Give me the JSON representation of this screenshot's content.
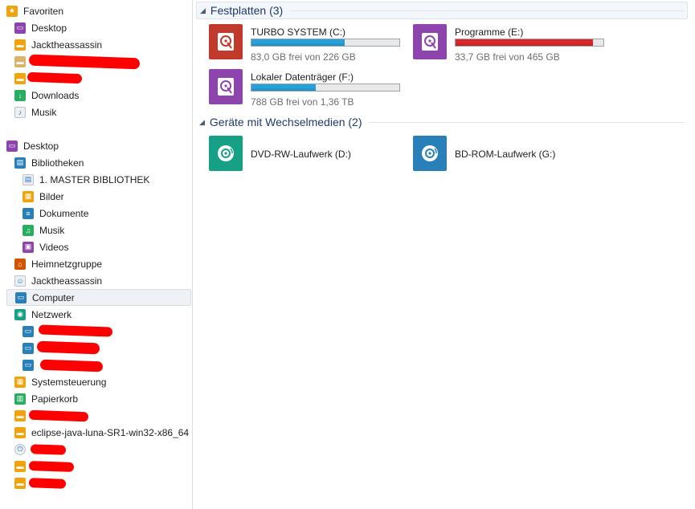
{
  "nav": {
    "favorites": {
      "header": "Favoriten",
      "items": [
        "Desktop",
        "Jacktheassassin",
        "",
        "",
        "Downloads",
        "Musik"
      ]
    },
    "desktop": {
      "root": "Desktop",
      "libraries": "Bibliotheken",
      "library_items": [
        "1. MASTER BIBLIOTHEK",
        "Bilder",
        "Dokumente",
        "Musik",
        "Videos"
      ],
      "homegroup": "Heimnetzgruppe",
      "user": "Jacktheassassin",
      "computer": "Computer",
      "network": "Netzwerk",
      "network_items": [
        "",
        "",
        ""
      ],
      "control_panel": "Systemsteuerung",
      "recycle_bin": "Papierkorb",
      "folders": [
        "",
        "eclipse-java-luna-SR1-win32-x86_64",
        "",
        "",
        ""
      ]
    }
  },
  "groups": {
    "hard_drives": {
      "title": "Festplatten (3)",
      "drives": [
        {
          "name": "TURBO SYSTEM (C:)",
          "free": "83,0 GB frei von 226 GB",
          "used_fraction": 0.633,
          "color": "#c0392b"
        },
        {
          "name": "Programme (E:)",
          "free": "33,7 GB frei von 465 GB",
          "used_fraction": 0.928,
          "color": "#8e44ad"
        },
        {
          "name": "Lokaler Datenträger (F:)",
          "free": "788 GB frei von 1,36 TB",
          "used_fraction": 0.434,
          "color": "#8e44ad"
        }
      ]
    },
    "removable": {
      "title": "Geräte mit Wechselmedien (2)",
      "devices": [
        {
          "name": "DVD-RW-Laufwerk (D:)",
          "color": "#16a085"
        },
        {
          "name": "BD-ROM-Laufwerk (G:)",
          "color": "#2980b9"
        }
      ]
    }
  },
  "colors": {
    "bar_normal": "#26a0da",
    "bar_full": "#da2626"
  }
}
